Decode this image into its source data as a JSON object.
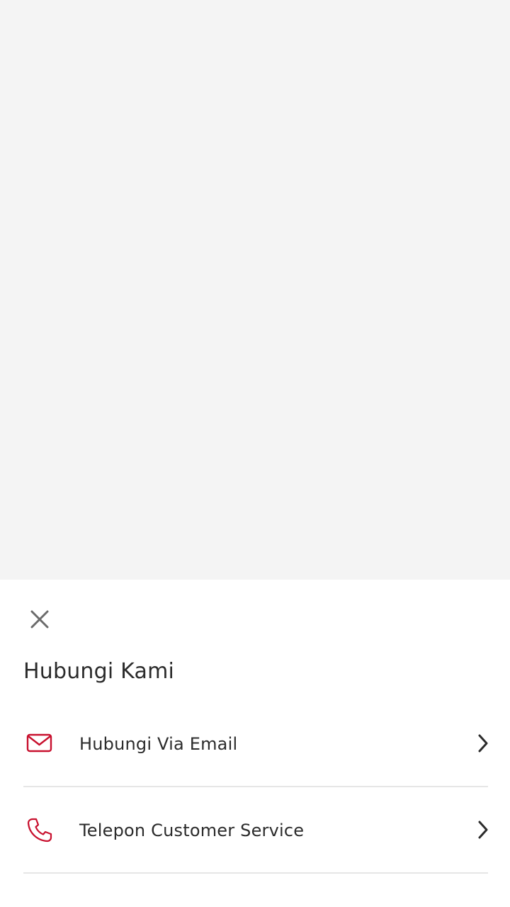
{
  "sheet": {
    "title": "Hubungi Kami",
    "close_icon": "close-icon",
    "options": [
      {
        "label": "Hubungi Via Email",
        "icon": "mail-icon",
        "trailing_icon": "chevron-right-icon"
      },
      {
        "label": "Telepon Customer Service",
        "icon": "phone-icon",
        "trailing_icon": "chevron-right-icon"
      }
    ]
  },
  "colors": {
    "backdrop": "#f4f4f4",
    "sheet_bg": "#ffffff",
    "accent": "#c8102e",
    "text": "#2b2b2b",
    "divider": "#e6e6e6",
    "close_icon": "#6b6b6b"
  }
}
